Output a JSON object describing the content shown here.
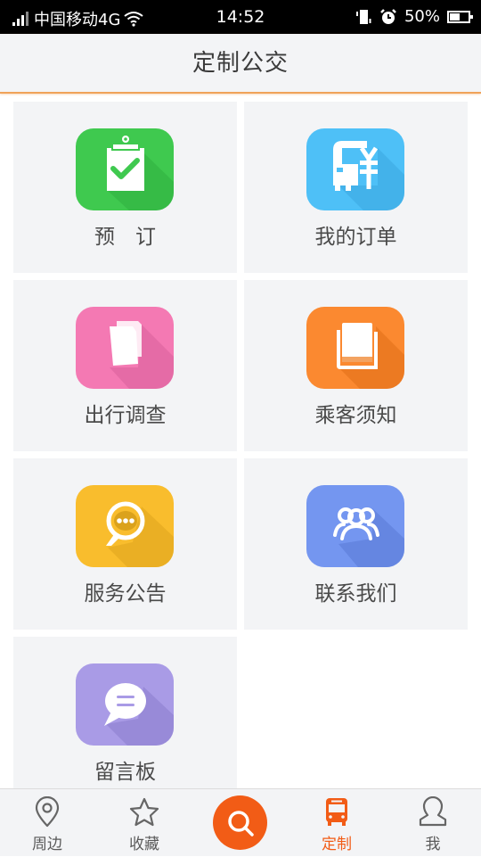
{
  "status_bar": {
    "carrier": "中国移动4G",
    "time": "14:52",
    "battery": "50%",
    "icons": [
      "signal-icon",
      "wifi-icon",
      "vibrate-icon",
      "alarm-icon",
      "battery-icon"
    ]
  },
  "header": {
    "title": "定制公交"
  },
  "menu": [
    {
      "label": "预　订",
      "icon": "clipboard-check-icon",
      "color": "#3fc94f"
    },
    {
      "label": "我的订单",
      "icon": "bus-yuan-icon",
      "color": "#4ec0f7"
    },
    {
      "label": "出行调查",
      "icon": "documents-icon",
      "color": "#f479b3"
    },
    {
      "label": "乘客须知",
      "icon": "book-icon",
      "color": "#fb8930"
    },
    {
      "label": "服务公告",
      "icon": "speech-bubble-dots-icon",
      "color": "#f9bd2d"
    },
    {
      "label": "联系我们",
      "icon": "group-people-icon",
      "color": "#7496f0"
    },
    {
      "label": "留言板",
      "icon": "message-board-icon",
      "color": "#a99be6"
    }
  ],
  "bottom_nav": {
    "items": [
      {
        "label": "周边",
        "icon": "location-pin-icon"
      },
      {
        "label": "收藏",
        "icon": "star-icon"
      },
      {
        "label": "定制",
        "icon": "bus-icon",
        "active": true
      },
      {
        "label": "我",
        "icon": "user-icon"
      }
    ],
    "search_icon": "search-icon",
    "active_color": "#f25c16"
  }
}
